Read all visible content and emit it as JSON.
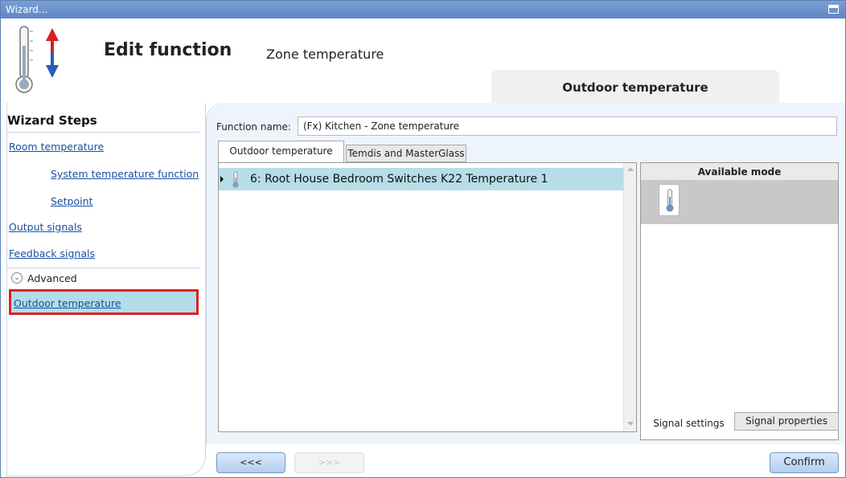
{
  "window": {
    "title": "Wizard..."
  },
  "header": {
    "title": "Edit function",
    "subtitle": "Zone temperature",
    "active_step_tab": "Outdoor temperature"
  },
  "sidebar": {
    "title": "Wizard Steps",
    "items": [
      {
        "label": "Room temperature"
      },
      {
        "label": "System temperature function"
      },
      {
        "label": "Setpoint"
      },
      {
        "label": "Output signals"
      },
      {
        "label": "Feedback signals"
      }
    ],
    "advanced_label": "Advanced",
    "selected_item": "Outdoor temperature"
  },
  "main": {
    "function_name_label": "Function name:",
    "function_name_value": "(Fx) Kitchen - Zone temperature",
    "tabs": [
      {
        "label": "Outdoor temperature",
        "active": true
      },
      {
        "label": "Temdis and MasterGlass",
        "active": false
      }
    ],
    "signals": [
      {
        "label": "6: Root House Bedroom Switches K22 Temperature 1",
        "icon": "thermometer-icon",
        "selected": true
      }
    ],
    "available_mode": {
      "header": "Available mode",
      "modes": [
        {
          "icon": "thermometer-icon"
        }
      ]
    },
    "bottom_tabs": [
      {
        "label": "Signal settings",
        "active": true
      },
      {
        "label": "Signal properties",
        "active": false
      }
    ]
  },
  "footer": {
    "back_label": "<<<",
    "next_label": ">>>",
    "confirm_label": "Confirm"
  },
  "colors": {
    "titlebar": "#5d86c4",
    "selection": "#b6dde8",
    "highlight_border": "#e02020",
    "link": "#1a4fa0"
  }
}
